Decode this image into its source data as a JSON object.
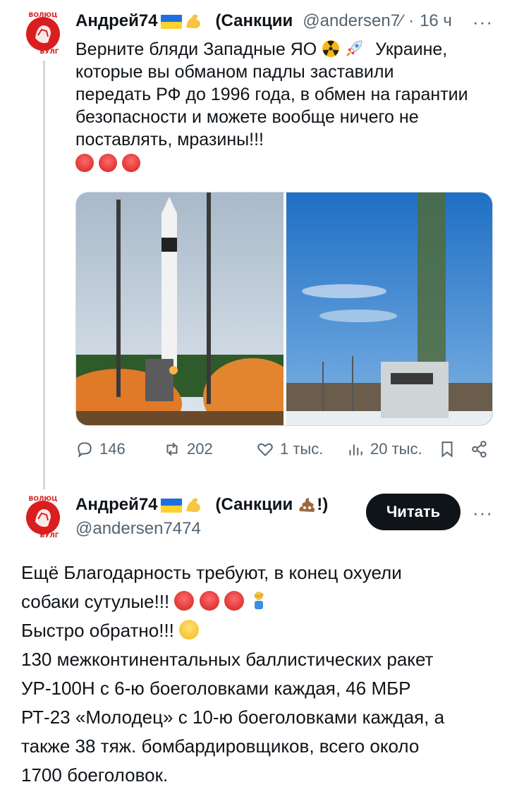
{
  "tweet1": {
    "author_name": "Андрей74",
    "author_suffix": "(Санкции",
    "handle": "@andersen7⁄",
    "dot": "·",
    "time": "16 ч",
    "more": "···",
    "text_lines": [
      "Верните бляди Западные ЯО",
      "которые вы обманом падлы заставили",
      "передать РФ до 1996 года, в обмен на гарантии",
      "безопасности и можете вообще ничего не",
      "поставлять, мразины!!!"
    ],
    "text_line1_tail": "Украине,",
    "stats": {
      "replies": "146",
      "reposts": "202",
      "likes": "1 тыс.",
      "views": "20 тыс."
    }
  },
  "tweet2": {
    "author_name": "Андрей74",
    "author_suffix": "(Санкции",
    "author_suffix_end": "!)",
    "handle": "@andersen7474",
    "follow_label": "Читать",
    "more": "···",
    "text_lines": [
      "Ещё Благодарность требуют, в конец охуели",
      "собаки сутулые!!!",
      "Быстро обратно!!!",
      "130 межконтинентальных баллистических ракет",
      "УР-100Н с 6-ю боеголовками каждая, 46 МБР",
      "РТ-23 «Молодец» с 10-ю боеголовками каждая, а",
      "также 38 тяж. бомбардировщиков, всего около",
      "1700 боеголовок."
    ]
  },
  "avatar": {
    "text_top": "ВОЛЮЦ",
    "text_bottom": "БУЛГ"
  },
  "icons": [
    "reply-icon",
    "repost-icon",
    "like-icon",
    "views-icon",
    "bookmark-icon",
    "share-icon",
    "more-icon",
    "ukraine-flag-icon",
    "flexed-bicep-icon",
    "radioactive-icon",
    "rocket-icon",
    "angry-face-icon",
    "poop-icon",
    "facepalm-icon",
    "expressionless-face-icon"
  ],
  "colors": {
    "text": "#0f1419",
    "secondary": "#536471",
    "button_bg": "#0f1419",
    "button_text": "#ffffff",
    "thread_line": "#cfd9de"
  }
}
